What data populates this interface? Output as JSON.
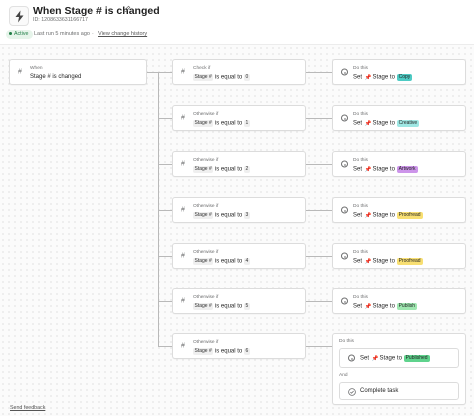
{
  "header": {
    "title": "When Stage # is changed",
    "id_line": "ID: 1208633631166717",
    "status": "Active",
    "last_run": "Last run 5 minutes ago",
    "separator": "·",
    "history_link": "View change history"
  },
  "trigger": {
    "label": "When",
    "text": "Stage # is changed"
  },
  "rules": [
    {
      "label": "Check if",
      "field": "Stage #",
      "op": "is equal to",
      "value": "0",
      "action_label": "Do this",
      "action_prefix": "Set",
      "action_field": "Stage",
      "action_to": "to",
      "action_value": "Copy",
      "tag_color": "#4ecbc4"
    },
    {
      "label": "Otherwise if",
      "field": "Stage #",
      "op": "is equal to",
      "value": "1",
      "action_label": "Do this",
      "action_prefix": "Set",
      "action_field": "Stage",
      "action_to": "to",
      "action_value": "Creative",
      "tag_color": "#9ee7e3"
    },
    {
      "label": "Otherwise if",
      "field": "Stage #",
      "op": "is equal to",
      "value": "2",
      "action_label": "Do this",
      "action_prefix": "Set",
      "action_field": "Stage",
      "action_to": "to",
      "action_value": "Artwork",
      "tag_color": "#cd95ea"
    },
    {
      "label": "Otherwise if",
      "field": "Stage #",
      "op": "is equal to",
      "value": "3",
      "action_label": "Do this",
      "action_prefix": "Set",
      "action_field": "Stage",
      "action_to": "to",
      "action_value": "Proofread",
      "tag_color": "#f8df72"
    },
    {
      "label": "Otherwise if",
      "field": "Stage #",
      "op": "is equal to",
      "value": "4",
      "action_label": "Do this",
      "action_prefix": "Set",
      "action_field": "Stage",
      "action_to": "to",
      "action_value": "Proofread",
      "tag_color": "#f8df72"
    },
    {
      "label": "Otherwise if",
      "field": "Stage #",
      "op": "is equal to",
      "value": "5",
      "action_label": "Do this",
      "action_prefix": "Set",
      "action_field": "Stage",
      "action_to": "to",
      "action_value": "Publish",
      "tag_color": "#9ee7b0"
    },
    {
      "label": "Otherwise if",
      "field": "Stage #",
      "op": "is equal to",
      "value": "6",
      "action_label": "Do this",
      "action_prefix": "Set",
      "action_field": "Stage",
      "action_to": "to",
      "action_value": "Published",
      "tag_color": "#5fd38d"
    }
  ],
  "last_action": {
    "and_label": "And",
    "complete_text": "Complete task"
  },
  "footer": {
    "feedback": "Send feedback"
  },
  "icons": {
    "header": "lightning-bolt-icon",
    "edit": "pencil-icon",
    "condition": "hash-icon",
    "action": "state-machine-icon",
    "stage": "pushpin-icon",
    "complete": "check-circle-icon"
  }
}
